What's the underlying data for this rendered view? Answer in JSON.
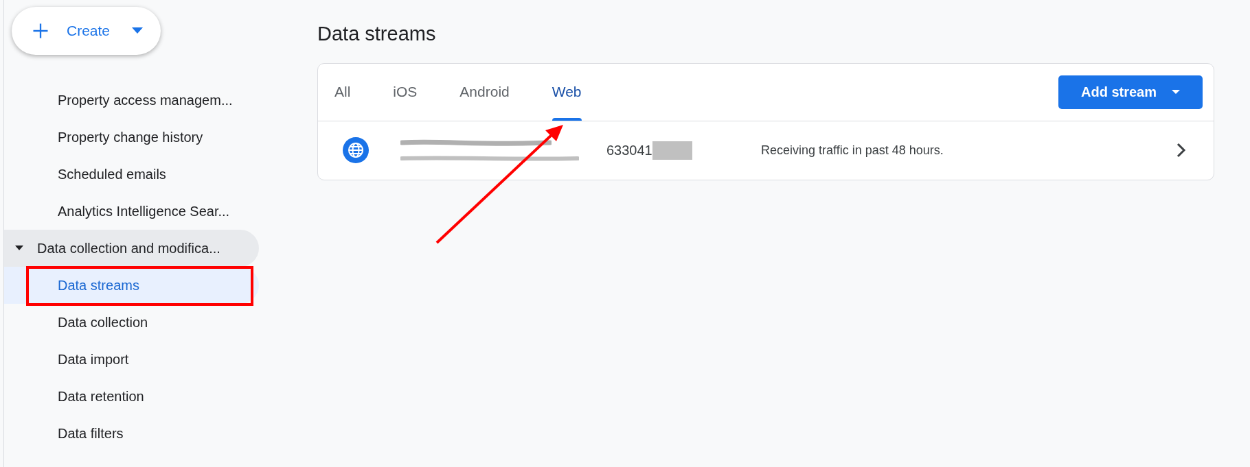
{
  "create_button": {
    "label": "Create"
  },
  "sidebar": {
    "items": [
      {
        "kind": "item",
        "label": "Property access managem...",
        "selected": false,
        "outlined": false
      },
      {
        "kind": "item",
        "label": "Property change history",
        "selected": false,
        "outlined": false
      },
      {
        "kind": "item",
        "label": "Scheduled emails",
        "selected": false,
        "outlined": false
      },
      {
        "kind": "item",
        "label": "Analytics Intelligence Sear...",
        "selected": false,
        "outlined": false
      },
      {
        "kind": "group",
        "label": "Data collection and modifica...",
        "expanded": true
      },
      {
        "kind": "item",
        "label": "Data streams",
        "selected": true,
        "outlined": true
      },
      {
        "kind": "item",
        "label": "Data collection",
        "selected": false,
        "outlined": false
      },
      {
        "kind": "item",
        "label": "Data import",
        "selected": false,
        "outlined": false
      },
      {
        "kind": "item",
        "label": "Data retention",
        "selected": false,
        "outlined": false
      },
      {
        "kind": "item",
        "label": "Data filters",
        "selected": false,
        "outlined": false
      }
    ]
  },
  "page": {
    "title": "Data streams",
    "tabs": [
      {
        "label": "All",
        "selected": false,
        "arrow_pointer": false
      },
      {
        "label": "iOS",
        "selected": false,
        "arrow_pointer": false
      },
      {
        "label": "Android",
        "selected": false,
        "arrow_pointer": false
      },
      {
        "label": "Web",
        "selected": true,
        "arrow_pointer": true
      }
    ],
    "add_button": {
      "label": "Add stream"
    },
    "streams": [
      {
        "id": "633041",
        "status": "Receiving traffic in past 48 hours.",
        "redacted": true
      }
    ]
  }
}
